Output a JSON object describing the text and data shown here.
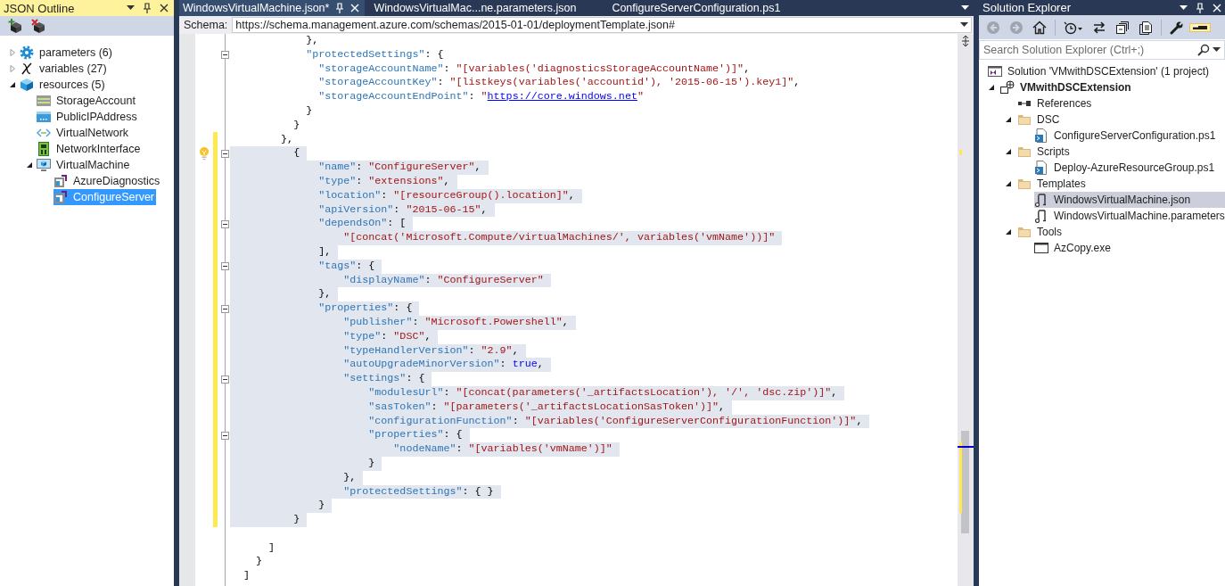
{
  "json_outline": {
    "title": "JSON Outline",
    "toolbar": [
      {
        "kind": "add"
      },
      {
        "kind": "remove"
      }
    ],
    "items": [
      {
        "label": "parameters (6)",
        "kind": "parameters",
        "expanded": false,
        "selected": false
      },
      {
        "label": "variables (27)",
        "kind": "variables",
        "expanded": false,
        "selected": false
      },
      {
        "label": "resources (5)",
        "kind": "resources",
        "expanded": true,
        "selected": false,
        "children": [
          {
            "label": "StorageAccount",
            "kind": "storage",
            "selected": false
          },
          {
            "label": "PublicIPAddress",
            "kind": "ip",
            "selected": false
          },
          {
            "label": "VirtualNetwork",
            "kind": "network",
            "selected": false
          },
          {
            "label": "NetworkInterface",
            "kind": "nic",
            "selected": false
          },
          {
            "label": "VirtualMachine",
            "kind": "vm",
            "expanded": true,
            "selected": false,
            "children": [
              {
                "label": "AzureDiagnostics",
                "kind": "extension",
                "selected": false
              },
              {
                "label": "ConfigureServer",
                "kind": "extension",
                "selected": true
              }
            ]
          }
        ]
      }
    ]
  },
  "editor": {
    "tabs": [
      {
        "label": "WindowsVirtualMachine.json*",
        "selected": true
      },
      {
        "label": "WindowsVirtualMac...ne.parameters.json",
        "selected": false
      },
      {
        "label": "ConfigureServerConfiguration.ps1",
        "selected": false
      }
    ],
    "schema": {
      "label": "Schema:",
      "value": "https://schema.management.azure.com/schemas/2015-01-01/deploymentTemplate.json#"
    },
    "lines": [
      {
        "tokens": [
          {
            "kind": "punct",
            "text": "            },"
          }
        ],
        "selected": false,
        "changed": false,
        "collapsible": false,
        "hint": false
      },
      {
        "tokens": [
          {
            "kind": "key",
            "text": "            \"protectedSettings\""
          },
          {
            "kind": "punct",
            "text": ": {"
          }
        ],
        "selected": false,
        "changed": false,
        "collapsible": true,
        "hint": false
      },
      {
        "tokens": [
          {
            "kind": "key",
            "text": "              \"storageAccountName\""
          },
          {
            "kind": "punct",
            "text": ": "
          },
          {
            "kind": "string",
            "text": "\"[variables('diagnosticsStorageAccountName')]\""
          },
          {
            "kind": "punct",
            "text": ","
          }
        ],
        "selected": false,
        "changed": false,
        "collapsible": false,
        "hint": false
      },
      {
        "tokens": [
          {
            "kind": "key",
            "text": "              \"storageAccountKey\""
          },
          {
            "kind": "punct",
            "text": ": "
          },
          {
            "kind": "string",
            "text": "\"[listkeys(variables('accountid'), '2015-06-15').key1]\""
          },
          {
            "kind": "punct",
            "text": ","
          }
        ],
        "selected": false,
        "changed": false,
        "collapsible": false,
        "hint": false
      },
      {
        "tokens": [
          {
            "kind": "key",
            "text": "              \"storageAccountEndPoint\""
          },
          {
            "kind": "punct",
            "text": ": "
          },
          {
            "kind": "string",
            "text": "\""
          },
          {
            "kind": "link",
            "text": "https://core.windows.net"
          },
          {
            "kind": "string",
            "text": "\""
          }
        ],
        "selected": false,
        "changed": false,
        "collapsible": false,
        "hint": false
      },
      {
        "tokens": [
          {
            "kind": "punct",
            "text": "            }"
          }
        ],
        "selected": false,
        "changed": false,
        "collapsible": false,
        "hint": false
      },
      {
        "tokens": [
          {
            "kind": "punct",
            "text": "          }"
          }
        ],
        "selected": false,
        "changed": false,
        "collapsible": false,
        "hint": false
      },
      {
        "tokens": [
          {
            "kind": "punct",
            "text": "        },"
          }
        ],
        "selected": false,
        "changed": true,
        "collapsible": false,
        "hint": false
      },
      {
        "tokens": [
          {
            "kind": "punct",
            "text": "          {"
          }
        ],
        "selected": true,
        "changed": true,
        "collapsible": true,
        "hint": true
      },
      {
        "tokens": [
          {
            "kind": "key",
            "text": "              \"name\""
          },
          {
            "kind": "punct",
            "text": ": "
          },
          {
            "kind": "string",
            "text": "\"ConfigureServer\""
          },
          {
            "kind": "punct",
            "text": ","
          }
        ],
        "selected": true,
        "changed": true,
        "collapsible": false,
        "hint": false
      },
      {
        "tokens": [
          {
            "kind": "key",
            "text": "              \"type\""
          },
          {
            "kind": "punct",
            "text": ": "
          },
          {
            "kind": "string",
            "text": "\"extensions\""
          },
          {
            "kind": "punct",
            "text": ","
          }
        ],
        "selected": true,
        "changed": true,
        "collapsible": false,
        "hint": false
      },
      {
        "tokens": [
          {
            "kind": "key",
            "text": "              \"location\""
          },
          {
            "kind": "punct",
            "text": ": "
          },
          {
            "kind": "string",
            "text": "\"[resourceGroup().location]\""
          },
          {
            "kind": "punct",
            "text": ","
          }
        ],
        "selected": true,
        "changed": true,
        "collapsible": false,
        "hint": false
      },
      {
        "tokens": [
          {
            "kind": "key",
            "text": "              \"apiVersion\""
          },
          {
            "kind": "punct",
            "text": ": "
          },
          {
            "kind": "string",
            "text": "\"2015-06-15\""
          },
          {
            "kind": "punct",
            "text": ","
          }
        ],
        "selected": true,
        "changed": true,
        "collapsible": false,
        "hint": false
      },
      {
        "tokens": [
          {
            "kind": "key",
            "text": "              \"dependsOn\""
          },
          {
            "kind": "punct",
            "text": ": ["
          }
        ],
        "selected": true,
        "changed": true,
        "collapsible": true,
        "hint": false
      },
      {
        "tokens": [
          {
            "kind": "string",
            "text": "                  \"[concat('Microsoft.Compute/virtualMachines/', variables('vmName'))]\""
          }
        ],
        "selected": true,
        "changed": true,
        "collapsible": false,
        "hint": false
      },
      {
        "tokens": [
          {
            "kind": "punct",
            "text": "              ],"
          }
        ],
        "selected": true,
        "changed": true,
        "collapsible": false,
        "hint": false
      },
      {
        "tokens": [
          {
            "kind": "key",
            "text": "              \"tags\""
          },
          {
            "kind": "punct",
            "text": ": {"
          }
        ],
        "selected": true,
        "changed": true,
        "collapsible": true,
        "hint": false
      },
      {
        "tokens": [
          {
            "kind": "key",
            "text": "                  \"displayName\""
          },
          {
            "kind": "punct",
            "text": ": "
          },
          {
            "kind": "string",
            "text": "\"ConfigureServer\""
          }
        ],
        "selected": true,
        "changed": true,
        "collapsible": false,
        "hint": false
      },
      {
        "tokens": [
          {
            "kind": "punct",
            "text": "              },"
          }
        ],
        "selected": true,
        "changed": true,
        "collapsible": false,
        "hint": false
      },
      {
        "tokens": [
          {
            "kind": "key",
            "text": "              \"properties\""
          },
          {
            "kind": "punct",
            "text": ": {"
          }
        ],
        "selected": true,
        "changed": true,
        "collapsible": true,
        "hint": false
      },
      {
        "tokens": [
          {
            "kind": "key",
            "text": "                  \"publisher\""
          },
          {
            "kind": "punct",
            "text": ": "
          },
          {
            "kind": "string",
            "text": "\"Microsoft.Powershell\""
          },
          {
            "kind": "punct",
            "text": ","
          }
        ],
        "selected": true,
        "changed": true,
        "collapsible": false,
        "hint": false
      },
      {
        "tokens": [
          {
            "kind": "key",
            "text": "                  \"type\""
          },
          {
            "kind": "punct",
            "text": ": "
          },
          {
            "kind": "string",
            "text": "\"DSC\""
          },
          {
            "kind": "punct",
            "text": ","
          }
        ],
        "selected": true,
        "changed": true,
        "collapsible": false,
        "hint": false
      },
      {
        "tokens": [
          {
            "kind": "key",
            "text": "                  \"typeHandlerVersion\""
          },
          {
            "kind": "punct",
            "text": ": "
          },
          {
            "kind": "string",
            "text": "\"2.9\""
          },
          {
            "kind": "punct",
            "text": ","
          }
        ],
        "selected": true,
        "changed": true,
        "collapsible": false,
        "hint": false
      },
      {
        "tokens": [
          {
            "kind": "key",
            "text": "                  \"autoUpgradeMinorVersion\""
          },
          {
            "kind": "punct",
            "text": ": "
          },
          {
            "kind": "keyword",
            "text": "true"
          },
          {
            "kind": "punct",
            "text": ","
          }
        ],
        "selected": true,
        "changed": true,
        "collapsible": false,
        "hint": false
      },
      {
        "tokens": [
          {
            "kind": "key",
            "text": "                  \"settings\""
          },
          {
            "kind": "punct",
            "text": ": {"
          }
        ],
        "selected": true,
        "changed": true,
        "collapsible": true,
        "hint": false
      },
      {
        "tokens": [
          {
            "kind": "key",
            "text": "                      \"modulesUrl\""
          },
          {
            "kind": "punct",
            "text": ": "
          },
          {
            "kind": "string",
            "text": "\"[concat(parameters('_artifactsLocation'), '/', 'dsc.zip')]\""
          },
          {
            "kind": "punct",
            "text": ","
          }
        ],
        "selected": true,
        "changed": true,
        "collapsible": false,
        "hint": false
      },
      {
        "tokens": [
          {
            "kind": "key",
            "text": "                      \"sasToken\""
          },
          {
            "kind": "punct",
            "text": ": "
          },
          {
            "kind": "string",
            "text": "\"[parameters('_artifactsLocationSasToken')]\""
          },
          {
            "kind": "punct",
            "text": ","
          }
        ],
        "selected": true,
        "changed": true,
        "collapsible": false,
        "hint": false
      },
      {
        "tokens": [
          {
            "kind": "key",
            "text": "                      \"configurationFunction\""
          },
          {
            "kind": "punct",
            "text": ": "
          },
          {
            "kind": "string",
            "text": "\"[variables('ConfigureServerConfigurationFunction')]\""
          },
          {
            "kind": "punct",
            "text": ","
          }
        ],
        "selected": true,
        "changed": true,
        "collapsible": false,
        "hint": false
      },
      {
        "tokens": [
          {
            "kind": "key",
            "text": "                      \"properties\""
          },
          {
            "kind": "punct",
            "text": ": {"
          }
        ],
        "selected": true,
        "changed": true,
        "collapsible": true,
        "hint": false
      },
      {
        "tokens": [
          {
            "kind": "key",
            "text": "                          \"nodeName\""
          },
          {
            "kind": "punct",
            "text": ": "
          },
          {
            "kind": "string",
            "text": "\"[variables('vmName')]\""
          }
        ],
        "selected": true,
        "changed": true,
        "collapsible": false,
        "hint": false
      },
      {
        "tokens": [
          {
            "kind": "punct",
            "text": "                      }"
          }
        ],
        "selected": true,
        "changed": true,
        "collapsible": false,
        "hint": false
      },
      {
        "tokens": [
          {
            "kind": "punct",
            "text": "                  },"
          }
        ],
        "selected": true,
        "changed": true,
        "collapsible": false,
        "hint": false
      },
      {
        "tokens": [
          {
            "kind": "key",
            "text": "                  \"protectedSettings\""
          },
          {
            "kind": "punct",
            "text": ": { }"
          }
        ],
        "selected": true,
        "changed": true,
        "collapsible": false,
        "hint": false
      },
      {
        "tokens": [
          {
            "kind": "punct",
            "text": "              }"
          }
        ],
        "selected": true,
        "changed": true,
        "collapsible": false,
        "hint": false
      },
      {
        "tokens": [
          {
            "kind": "punct",
            "text": "          }"
          }
        ],
        "selected": true,
        "changed": true,
        "collapsible": false,
        "hint": false
      },
      {
        "selected": false,
        "changed": false,
        "collapsible": false,
        "hint": false
      },
      {
        "tokens": [
          {
            "kind": "punct",
            "text": "      ]"
          }
        ],
        "selected": false,
        "changed": false,
        "collapsible": false,
        "hint": false
      },
      {
        "tokens": [
          {
            "kind": "punct",
            "text": "    }"
          }
        ],
        "selected": false,
        "changed": false,
        "collapsible": false,
        "hint": false
      },
      {
        "tokens": [
          {
            "kind": "punct",
            "text": "  ]"
          }
        ],
        "selected": false,
        "changed": false,
        "collapsible": false,
        "hint": false
      }
    ]
  },
  "solution_explorer": {
    "title": "Solution Explorer",
    "toolbar": [
      {
        "kind": "back",
        "disabled": true,
        "on": false
      },
      {
        "kind": "forward",
        "disabled": true,
        "on": false
      },
      {
        "kind": "home",
        "disabled": false,
        "on": false
      },
      {
        "kind": "history",
        "disabled": false,
        "on": false
      },
      {
        "kind": "sync",
        "disabled": false,
        "on": false
      },
      {
        "kind": "collapse",
        "disabled": false,
        "on": false
      },
      {
        "kind": "showall",
        "disabled": false,
        "on": false
      },
      {
        "kind": "properties",
        "disabled": false,
        "on": false
      },
      {
        "kind": "preview",
        "disabled": false,
        "on": true
      }
    ],
    "search": {
      "placeholder": "Search Solution Explorer (Ctrl+;)"
    },
    "items": [
      {
        "label": "Solution 'VMwithDSCExtension' (1 project)",
        "kind": "solution",
        "selected": false
      },
      {
        "label": "VMwithDSCExtension",
        "kind": "project",
        "expanded": true,
        "selected": false,
        "children": [
          {
            "label": "References",
            "kind": "references",
            "selected": false
          },
          {
            "label": "DSC",
            "kind": "folder",
            "expanded": true,
            "selected": false,
            "children": [
              {
                "label": "ConfigureServerConfiguration.ps1",
                "kind": "script",
                "selected": false
              }
            ]
          },
          {
            "label": "Scripts",
            "kind": "folder",
            "expanded": true,
            "selected": false,
            "children": [
              {
                "label": "Deploy-AzureResourceGroup.ps1",
                "kind": "script",
                "selected": false
              }
            ]
          },
          {
            "label": "Templates",
            "kind": "folder",
            "expanded": true,
            "selected": false,
            "children": [
              {
                "label": "WindowsVirtualMachine.json",
                "kind": "json",
                "selected": true
              },
              {
                "label": "WindowsVirtualMachine.parameters",
                "kind": "json",
                "selected": false
              }
            ]
          },
          {
            "label": "Tools",
            "kind": "folder",
            "expanded": true,
            "selected": false,
            "children": [
              {
                "label": "AzCopy.exe",
                "kind": "exe",
                "selected": false
              }
            ]
          }
        ]
      }
    ]
  }
}
